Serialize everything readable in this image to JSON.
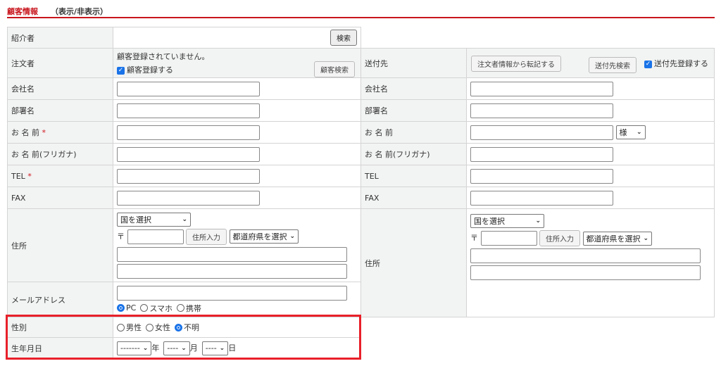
{
  "header": {
    "title": "顧客情報",
    "toggle": "（表示/非表示）"
  },
  "colors": {
    "accent": "#c8161d",
    "highlight": "#e8202a",
    "radio": "#1a73e8"
  },
  "left": {
    "referrer": {
      "label": "紹介者",
      "search": "検索"
    },
    "orderer": {
      "label": "注文者",
      "status": "顧客登録されていません。",
      "register": "顧客登録する",
      "search": "顧客検索"
    },
    "company": "会社名",
    "dept": "部署名",
    "name": "お 名 前",
    "kana": "お 名 前(フリガナ)",
    "tel": "TEL",
    "fax": "FAX",
    "required": "*",
    "address": {
      "label": "住所",
      "country": "国を選択",
      "zip_mark": "〒",
      "zip_button": "住所入力",
      "pref": "都道府県を選択"
    },
    "email": {
      "label": "メールアドレス",
      "types": [
        "PC",
        "スマホ",
        "携帯"
      ]
    },
    "gender": {
      "label": "性別",
      "options": [
        "男性",
        "女性",
        "不明"
      ]
    },
    "birth": {
      "label": "生年月日",
      "year": "-------",
      "year_unit": "年",
      "month": "----",
      "month_unit": "月",
      "day": "----",
      "day_unit": "日"
    }
  },
  "right": {
    "ship": {
      "label": "送付先",
      "copy": "注文者情報から転記する",
      "search": "送付先検索",
      "register": "送付先登録する"
    },
    "company": "会社名",
    "dept": "部署名",
    "name": "お 名 前",
    "honorific": "様",
    "kana": "お 名 前(フリガナ)",
    "tel": "TEL",
    "fax": "FAX",
    "address": {
      "label": "住所",
      "country": "国を選択",
      "zip_mark": "〒",
      "zip_button": "住所入力",
      "pref": "都道府県を選択"
    }
  }
}
